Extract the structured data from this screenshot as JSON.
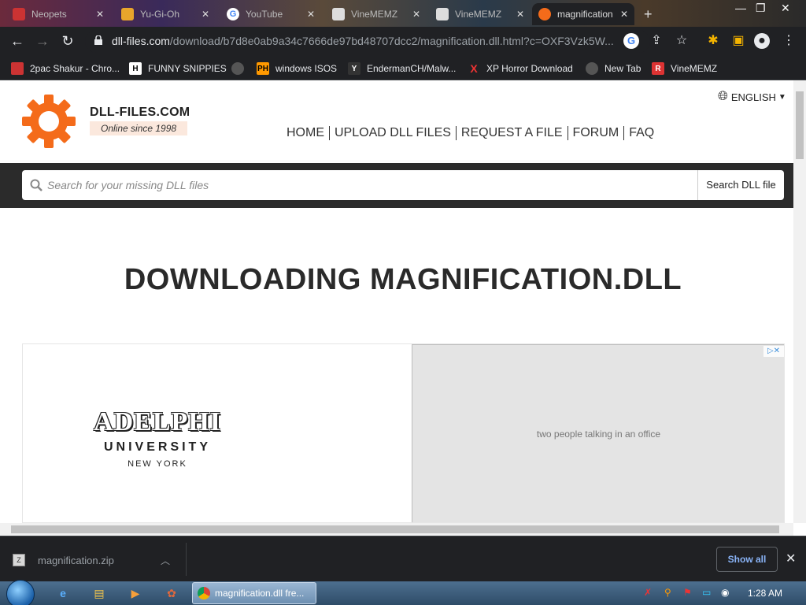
{
  "tabs": [
    {
      "title": "Neopets",
      "favicon": "#c33"
    },
    {
      "title": "Yu-Gi-Oh",
      "favicon": "#e9a52b"
    },
    {
      "title": "YouTube",
      "favicon": "google"
    },
    {
      "title": "VineMEMZ",
      "favicon": "#ddd"
    },
    {
      "title": "VineMEMZ",
      "favicon": "#ddd"
    },
    {
      "title": "magnification",
      "favicon": "#f46b1a"
    }
  ],
  "address": {
    "host": "dll-files.com",
    "path": "/download/b7d8e0ab9a34c7666de97bd48707dcc2/magnification.dll.html?c=OXF3Vzk5W..."
  },
  "bookmarks": [
    {
      "label": "2pac Shakur - Chro...",
      "icon_color": "#c33",
      "icon_text": ""
    },
    {
      "label": "FUNNY SNIPPIES",
      "icon_color": "#fff",
      "icon_text": "H"
    },
    {
      "label": "",
      "icon_color": "#555",
      "icon_text": ""
    },
    {
      "label": "windows ISOS",
      "icon_color": "#f90",
      "icon_text": "PH"
    },
    {
      "label": "EndermanCH/Malw...",
      "icon_color": "#333",
      "icon_text": "Y"
    },
    {
      "label": "XP Horror Download",
      "icon_color": "#e33",
      "icon_text": "X"
    },
    {
      "label": "New Tab",
      "icon_color": "#555",
      "icon_text": ""
    },
    {
      "label": "VineMEMZ",
      "icon_color": "#d33",
      "icon_text": "R"
    }
  ],
  "site": {
    "brand": "DLL-FILES.COM",
    "tagline": "Online since 1998",
    "language": "ENGLISH",
    "nav": [
      "HOME",
      "UPLOAD DLL FILES",
      "REQUEST A FILE",
      "FORUM",
      "FAQ"
    ],
    "search_placeholder": "Search for your missing DLL files",
    "search_button": "Search DLL file",
    "page_title": "DOWNLOADING MAGNIFICATION.DLL",
    "accent": "#f46b1a"
  },
  "ad": {
    "logo_line1": "ADELPHI",
    "logo_line2": "UNIVERSITY",
    "logo_line3": "NEW YORK",
    "photo_placeholder": "two people talking in an office"
  },
  "downloads": {
    "file": "magnification.zip",
    "show_all": "Show all"
  },
  "taskbar": {
    "window_title": "magnification.dll fre...",
    "clock": "1:28 AM"
  }
}
